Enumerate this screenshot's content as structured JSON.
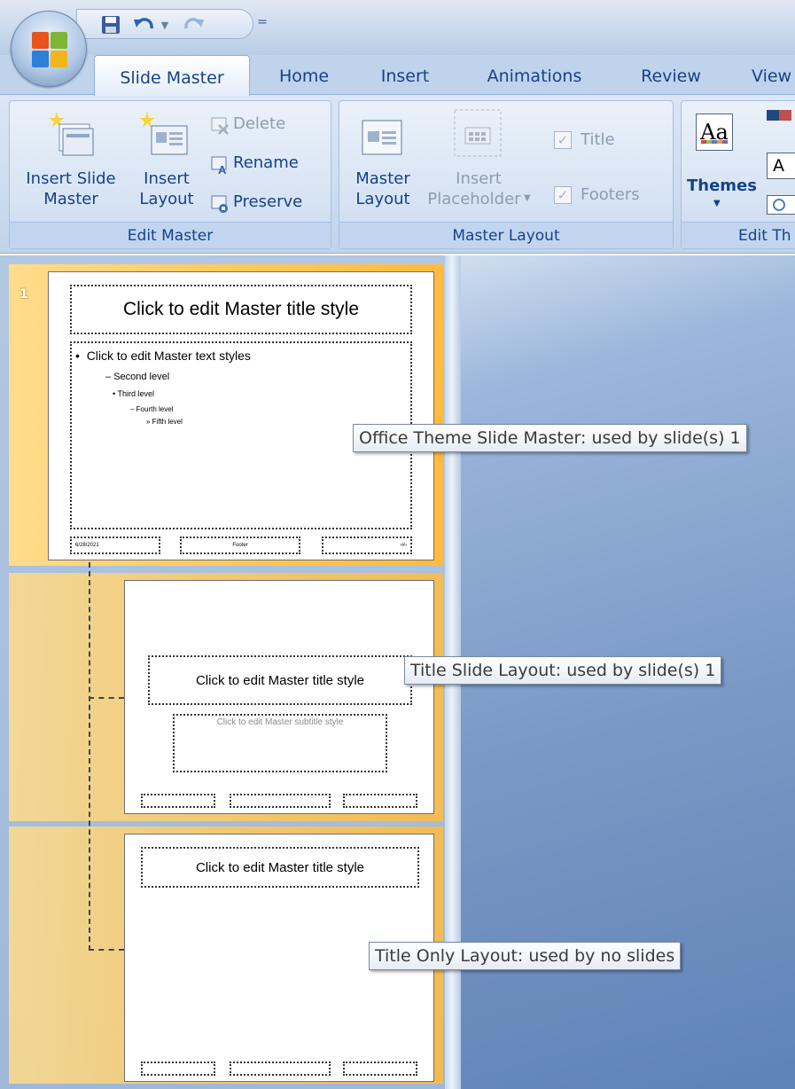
{
  "quick_access": {
    "icons": [
      "save-icon",
      "undo-icon",
      "undo-dropdown-icon",
      "redo-icon"
    ],
    "customize_glyph": "="
  },
  "tabs": [
    {
      "label": "Slide Master",
      "active": true
    },
    {
      "label": "Home"
    },
    {
      "label": "Insert"
    },
    {
      "label": "Animations"
    },
    {
      "label": "Review"
    },
    {
      "label": "View"
    }
  ],
  "ribbon": {
    "edit_master": {
      "label": "Edit Master",
      "insert_slide_master": [
        "Insert Slide",
        "Master"
      ],
      "insert_layout": [
        "Insert",
        "Layout"
      ],
      "delete": "Delete",
      "rename": "Rename",
      "preserve": "Preserve"
    },
    "master_layout": {
      "label": "Master Layout",
      "master_layout": [
        "Master",
        "Layout"
      ],
      "insert_placeholder": [
        "Insert",
        "Placeholder"
      ],
      "title": "Title",
      "footers": "Footers"
    },
    "edit_theme": {
      "label": "Edit Th",
      "themes": "Themes",
      "aa": "Aa",
      "font_a": "A"
    }
  },
  "slides": {
    "number": "1",
    "master": {
      "title": "Click to edit Master title style",
      "levels": [
        "Click to edit Master text styles",
        "Second level",
        "Third level",
        "Fourth level",
        "Fifth level"
      ],
      "footer_date": "6/28/2021",
      "footer_text": "Footer",
      "footer_num": "‹#›"
    },
    "title_slide": {
      "title": "Click to edit Master title style",
      "subtitle": "Click to edit Master subtitle style"
    },
    "title_only": {
      "title": "Click to edit Master title style"
    }
  },
  "tooltips": {
    "master": "Office Theme Slide Master: used by slide(s) 1",
    "title_slide": "Title Slide Layout: used by slide(s) 1",
    "title_only": "Title Only Layout: used by no slides"
  },
  "colors": {
    "ribbon_text": "#15428b",
    "selection": "#ffc85a",
    "workspace": "#7a99c6"
  }
}
